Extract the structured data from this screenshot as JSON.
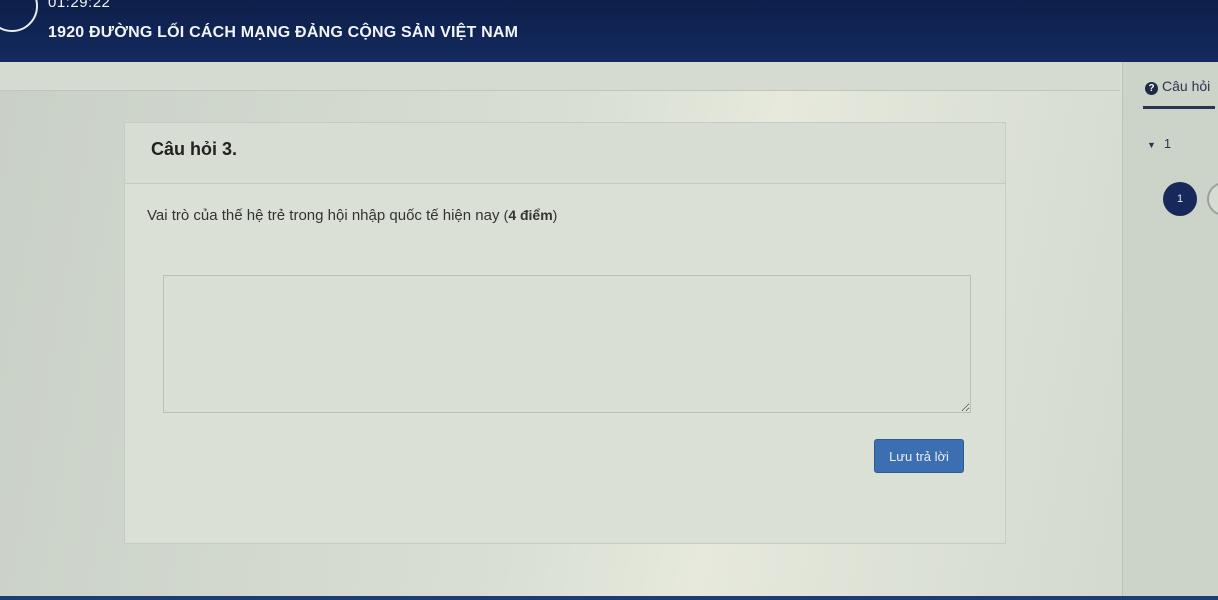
{
  "header": {
    "timer": "01:29:22",
    "course_title": "1920 ĐƯỜNG LỐI CÁCH MẠNG ĐẢNG CỘNG SẢN VIỆT NAM"
  },
  "question": {
    "title": "Câu hỏi 3.",
    "text": "Vai trò của thế hệ trẻ trong hội nhập quốc tế hiện nay",
    "points_open": "(",
    "points": "4 điểm",
    "points_close": ")",
    "answer_value": "",
    "save_label": "Lưu trả lời"
  },
  "sidebar": {
    "tab_label": "Câu hỏi",
    "section_label": "1",
    "badges": [
      "1",
      ""
    ]
  },
  "colors": {
    "topbar": "#0d1f4a",
    "accent_button": "#3c6fb0",
    "badge_active": "#17295a"
  },
  "icons": {
    "timer": "clock-icon",
    "help": "question-circle-icon",
    "toggle": "caret-down-icon"
  }
}
